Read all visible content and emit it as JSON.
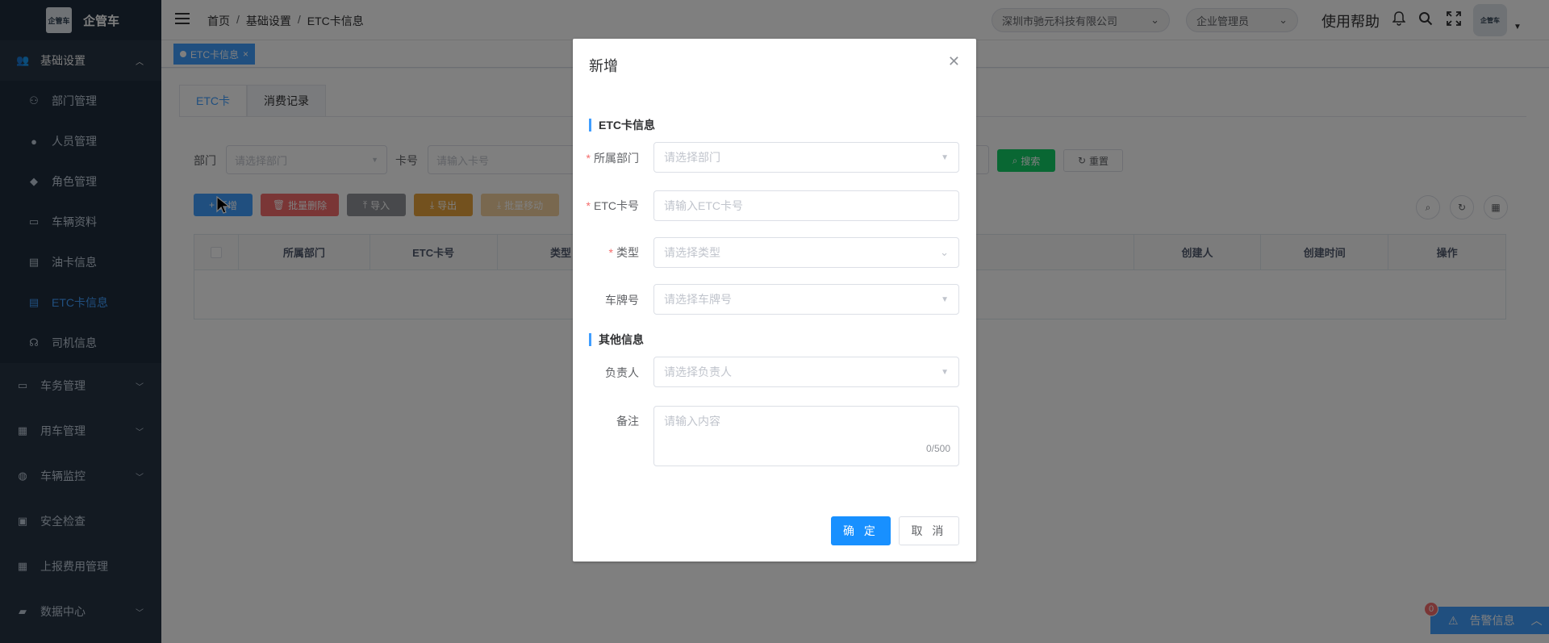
{
  "header": {
    "logo_text": "企管车",
    "logo_badge": "企管车",
    "breadcrumb": [
      "首页",
      "基础设置",
      "ETC卡信息"
    ],
    "company_select": "深圳市驰元科技有限公司",
    "role_select": "企业管理员",
    "help": "使用帮助"
  },
  "sidebar": {
    "items": [
      {
        "label": "基础设置",
        "icon": "users-icon",
        "expanded": true
      },
      {
        "label": "车务管理",
        "icon": "monitor-icon"
      },
      {
        "label": "用车管理",
        "icon": "clipboard-icon"
      },
      {
        "label": "车辆监控",
        "icon": "globe-icon"
      },
      {
        "label": "安全检查",
        "icon": "shield-icon"
      },
      {
        "label": "上报费用管理",
        "icon": "grid-icon"
      },
      {
        "label": "数据中心",
        "icon": "lock-icon"
      }
    ],
    "sub_items": [
      {
        "label": "部门管理",
        "icon": "tree-icon"
      },
      {
        "label": "人员管理",
        "icon": "user-icon"
      },
      {
        "label": "角色管理",
        "icon": "users-icon"
      },
      {
        "label": "车辆资料",
        "icon": "monitor-icon"
      },
      {
        "label": "油卡信息",
        "icon": "card-icon"
      },
      {
        "label": "ETC卡信息",
        "icon": "card-icon",
        "active": true
      },
      {
        "label": "司机信息",
        "icon": "driver-icon"
      }
    ]
  },
  "tagsbar": {
    "tag": "ETC卡信息"
  },
  "page": {
    "tabs": [
      "ETC卡",
      "消费记录"
    ],
    "filters": {
      "dept_label": "部门",
      "dept_placeholder": "请选择部门",
      "card_label": "卡号",
      "card_placeholder": "请输入卡号",
      "search": "搜索",
      "reset": "重置"
    },
    "toolbar": {
      "add": "新增",
      "batch_delete": "批量删除",
      "import": "导入",
      "export": "导出",
      "batch_change": "批量移动"
    },
    "table_headers": [
      "所属部门",
      "ETC卡号",
      "类型",
      "创建人",
      "创建时间",
      "操作"
    ]
  },
  "alert": {
    "label": "告警信息",
    "count": "0"
  },
  "modal": {
    "title": "新增",
    "section1": "ETC卡信息",
    "section2": "其他信息",
    "fields": {
      "dept": {
        "label": "所属部门",
        "placeholder": "请选择部门"
      },
      "etc": {
        "label": "ETC卡号",
        "placeholder": "请输入ETC卡号"
      },
      "type": {
        "label": "类型",
        "placeholder": "请选择类型"
      },
      "plate": {
        "label": "车牌号",
        "placeholder": "请选择车牌号"
      },
      "owner": {
        "label": "负责人",
        "placeholder": "请选择负责人"
      },
      "remark": {
        "label": "备注",
        "placeholder": "请输入内容",
        "count": "0/500"
      }
    },
    "confirm": "确 定",
    "cancel": "取 消"
  },
  "colors": {
    "primary": "#409eff",
    "sidebar_bg": "#263445",
    "danger": "#f56c6c",
    "info": "#909399",
    "warning": "#e6a23c",
    "search": "#13ce66"
  }
}
